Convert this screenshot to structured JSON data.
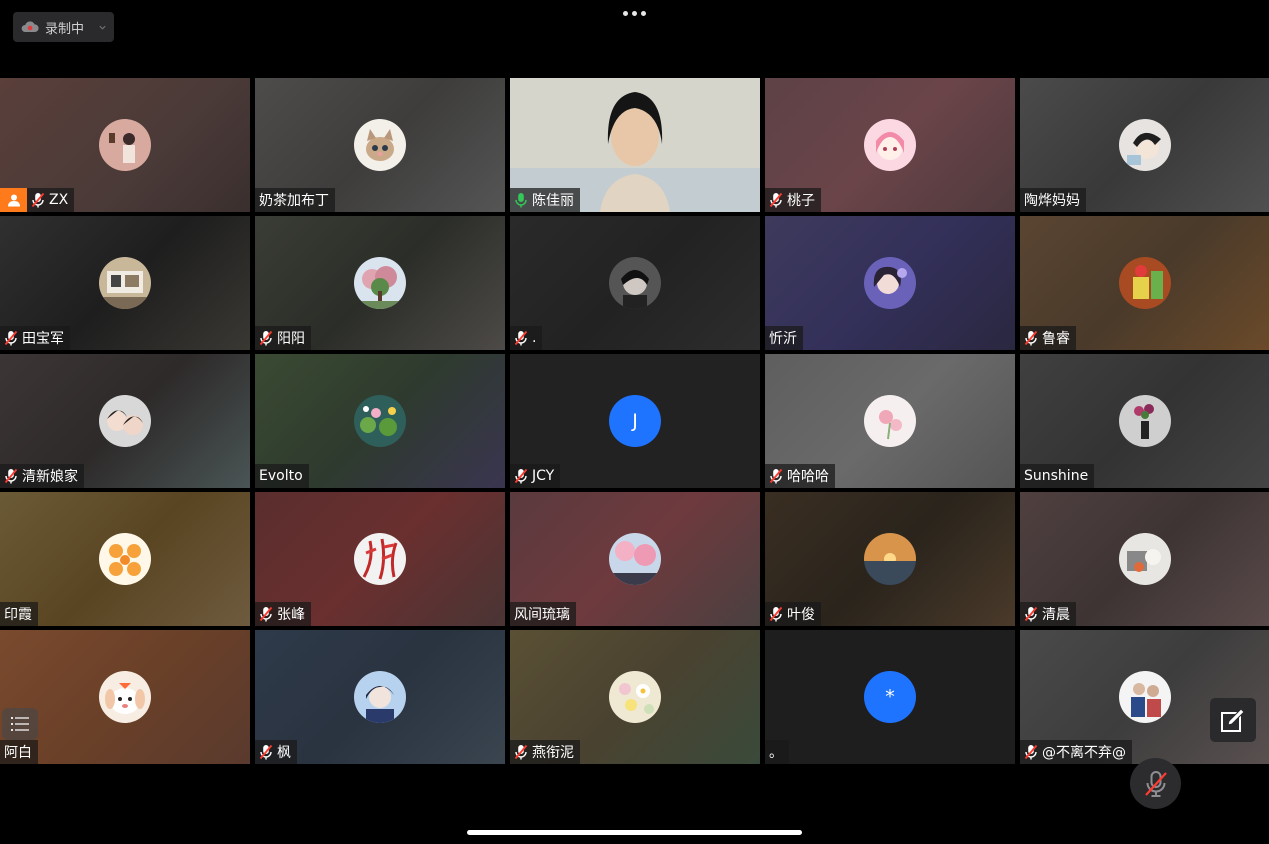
{
  "recording": {
    "label": "录制中"
  },
  "icons": {
    "recording": "cloud-icon",
    "more": "more-dots-icon",
    "host": "host-person-icon",
    "muted": "mic-muted-icon",
    "active_mic": "mic-active-icon",
    "list": "list-icon",
    "edit": "edit-pencil-icon",
    "mute_toggle": "mic-muted-icon"
  },
  "colors": {
    "host_badge": "#ff7a1a",
    "speaking_border": "#2fbf5b",
    "letter_avatar": "#1e74ff",
    "active_mic": "#34c759"
  },
  "participants": [
    {
      "name": "ZX",
      "muted": true,
      "host": true,
      "avatar": "photo"
    },
    {
      "name": "奶茶加布丁",
      "muted": false,
      "avatar": "cat"
    },
    {
      "name": "陈佳丽",
      "muted": false,
      "speaking": true,
      "video": true
    },
    {
      "name": "桃子",
      "muted": true,
      "avatar": "anime-girl"
    },
    {
      "name": "陶烨妈妈",
      "muted": false,
      "avatar": "anime-boy"
    },
    {
      "name": "田宝军",
      "muted": true,
      "avatar": "room"
    },
    {
      "name": "阳阳",
      "muted": true,
      "avatar": "tree"
    },
    {
      "name": ".",
      "muted": true,
      "avatar": "dark-portrait"
    },
    {
      "name": "忻沂",
      "muted": false,
      "avatar": "portrait"
    },
    {
      "name": "鲁睿",
      "muted": true,
      "avatar": "drink"
    },
    {
      "name": "清新娘家",
      "muted": true,
      "avatar": "selfie"
    },
    {
      "name": "Evolto",
      "muted": false,
      "avatar": "lotus"
    },
    {
      "name": "JCY",
      "muted": true,
      "avatar_letter": "J"
    },
    {
      "name": "哈哈哈",
      "muted": true,
      "avatar": "flowers"
    },
    {
      "name": "Sunshine",
      "muted": false,
      "avatar": "vase"
    },
    {
      "name": "印霞",
      "muted": false,
      "avatar": "tigers"
    },
    {
      "name": "张峰",
      "muted": true,
      "avatar": "bamboo"
    },
    {
      "name": "风间琉璃",
      "muted": false,
      "avatar": "blossom"
    },
    {
      "name": "叶俊",
      "muted": true,
      "avatar": "sunset"
    },
    {
      "name": "清晨",
      "muted": true,
      "avatar": "still-life"
    },
    {
      "name": "阿白",
      "muted": false,
      "avatar": "puppy"
    },
    {
      "name": "枫",
      "muted": true,
      "avatar": "anime-blue"
    },
    {
      "name": "燕衔泥",
      "muted": true,
      "avatar": "daisies"
    },
    {
      "name": "。",
      "muted": false,
      "avatar_letter": "*"
    },
    {
      "name": "@不离不弃@",
      "muted": true,
      "avatar": "couple"
    }
  ]
}
